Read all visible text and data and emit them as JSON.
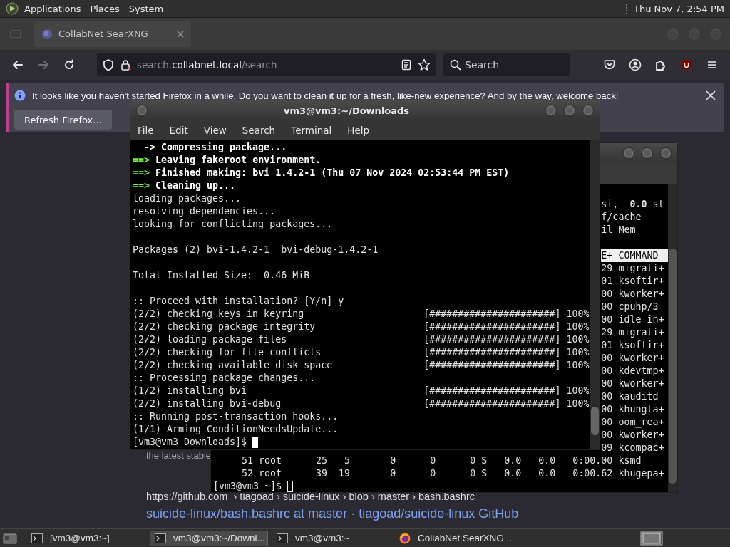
{
  "top_panel": {
    "menus": [
      "Applications",
      "Places",
      "System"
    ],
    "clock": "Thu Nov 7,  2:54 PM"
  },
  "browser": {
    "tabs": [
      {
        "title": "CollabNet SearXNG",
        "selected": true
      }
    ],
    "forward": {
      "disabled": true
    },
    "url": {
      "subdomain": "search.",
      "domain": "collabnet.local",
      "path": "/search"
    },
    "search": {
      "placeholder": "Search"
    },
    "notification": {
      "message": "It looks like you haven't started Firefox in a while. Do you want to clean it up for a fresh, like-new experience? And by the way, welcome back!",
      "button": "Refresh Firefox..."
    },
    "page": {
      "snippet": "the latest stable",
      "breadcrumb": "https://github.com  › tiagoad › suicide-linux › blob › master › bash.bashrc",
      "result_title": "suicide-linux/bash.bashrc at master · tiagoad/suicide-linux GitHub"
    }
  },
  "terminals": [
    {
      "focused": false,
      "lines": [
        {
          "kind": "blank"
        },
        {
          "kind": "partial",
          "text": "si,  **0.0** st"
        },
        {
          "kind": "partial",
          "text": "f/cache"
        },
        {
          "kind": "partial",
          "text": "il Mem"
        },
        {
          "kind": "blank"
        },
        {
          "kind": "header",
          "text": "E+ COMMAND"
        },
        {
          "kind": "partial",
          "text": "29 migrati+"
        },
        {
          "kind": "partial",
          "text": "01 ksoftir+"
        },
        {
          "kind": "partial",
          "text": "00 kworker+"
        },
        {
          "kind": "partial",
          "text": "00 cpuhp/3"
        },
        {
          "kind": "partial",
          "text": "00 idle_in+"
        },
        {
          "kind": "partial",
          "text": "29 migrati+"
        },
        {
          "kind": "partial",
          "text": "01 ksoftir+"
        },
        {
          "kind": "partial",
          "text": "00 kworker+"
        },
        {
          "kind": "partial",
          "text": "00 kdevtmp+"
        },
        {
          "kind": "partial",
          "text": "00 kworker+"
        },
        {
          "kind": "partial",
          "text": "00 kauditd"
        },
        {
          "kind": "partial",
          "text": "00 khungta+"
        },
        {
          "kind": "partial",
          "text": "00 oom_rea+"
        },
        {
          "kind": "partial",
          "text": "00 kworker+"
        },
        {
          "kind": "partial",
          "text": "09 kcompac+"
        },
        {
          "kind": "plain",
          "text": "     51 root      25   5       0      0      0 S   0.0   0.0   0:00.00 ksmd"
        },
        {
          "kind": "plain",
          "text": "     52 root      39  19       0      0      0 S   0.0   0.0   0:00.62 khugepa+"
        },
        {
          "kind": "prompt",
          "text": "[vm3@vm3 ~]$"
        }
      ]
    },
    {
      "focused": true,
      "title": "vm3@vm3:~/Downloads",
      "menu": [
        "File",
        "Edit",
        "View",
        "Search",
        "Terminal",
        "Help"
      ],
      "lines": [
        {
          "kind": "substep",
          "prefix": "->",
          "text": "Compressing package..."
        },
        {
          "kind": "step",
          "prefix": "==>",
          "text": "Leaving fakeroot environment."
        },
        {
          "kind": "step",
          "prefix": "==>",
          "text": "Finished making: bvi 1.4.2-1 (Thu 07 Nov 2024 02:53:44 PM EST)"
        },
        {
          "kind": "step",
          "prefix": "==>",
          "text": "Cleaning up..."
        },
        {
          "kind": "plain",
          "text": "loading packages..."
        },
        {
          "kind": "plain",
          "text": "resolving dependencies..."
        },
        {
          "kind": "plain",
          "text": "looking for conflicting packages..."
        },
        {
          "kind": "blank"
        },
        {
          "kind": "plain",
          "text": "Packages (2) bvi-1.4.2-1  bvi-debug-1.4.2-1"
        },
        {
          "kind": "blank"
        },
        {
          "kind": "plain",
          "text": "Total Installed Size:  0.46 MiB"
        },
        {
          "kind": "blank"
        },
        {
          "kind": "plain",
          "text": ":: Proceed with installation? [Y/n] y"
        },
        {
          "kind": "progress",
          "text": "(2/2) checking keys in keyring",
          "bar": "[######################]",
          "percent": "100%"
        },
        {
          "kind": "progress",
          "text": "(2/2) checking package integrity",
          "bar": "[######################]",
          "percent": "100%"
        },
        {
          "kind": "progress",
          "text": "(2/2) loading package files",
          "bar": "[######################]",
          "percent": "100%"
        },
        {
          "kind": "progress",
          "text": "(2/2) checking for file conflicts",
          "bar": "[######################]",
          "percent": "100%"
        },
        {
          "kind": "progress",
          "text": "(2/2) checking available disk space",
          "bar": "[######################]",
          "percent": "100%"
        },
        {
          "kind": "plain",
          "text": ":: Processing package changes..."
        },
        {
          "kind": "progress",
          "text": "(1/2) installing bvi",
          "bar": "[######################]",
          "percent": "100%"
        },
        {
          "kind": "progress",
          "text": "(2/2) installing bvi-debug",
          "bar": "[######################]",
          "percent": "100%"
        },
        {
          "kind": "plain",
          "text": ":: Running post-transaction hooks..."
        },
        {
          "kind": "plain",
          "text": "(1/1) Arming ConditionNeedsUpdate..."
        },
        {
          "kind": "prompt",
          "text": "[vm3@vm3 Downloads]$"
        }
      ]
    }
  ],
  "taskbar": {
    "items": [
      {
        "kind": "terminal",
        "label": "[vm3@vm3:~]",
        "selected": false
      },
      {
        "kind": "terminal",
        "label": "vm3@vm3:~/Downl...",
        "selected": true
      },
      {
        "kind": "terminal",
        "label": "vm3@vm3:~",
        "selected": false
      },
      {
        "kind": "browser",
        "label": "CollabNet SearXNG ...",
        "selected": false
      }
    ]
  }
}
